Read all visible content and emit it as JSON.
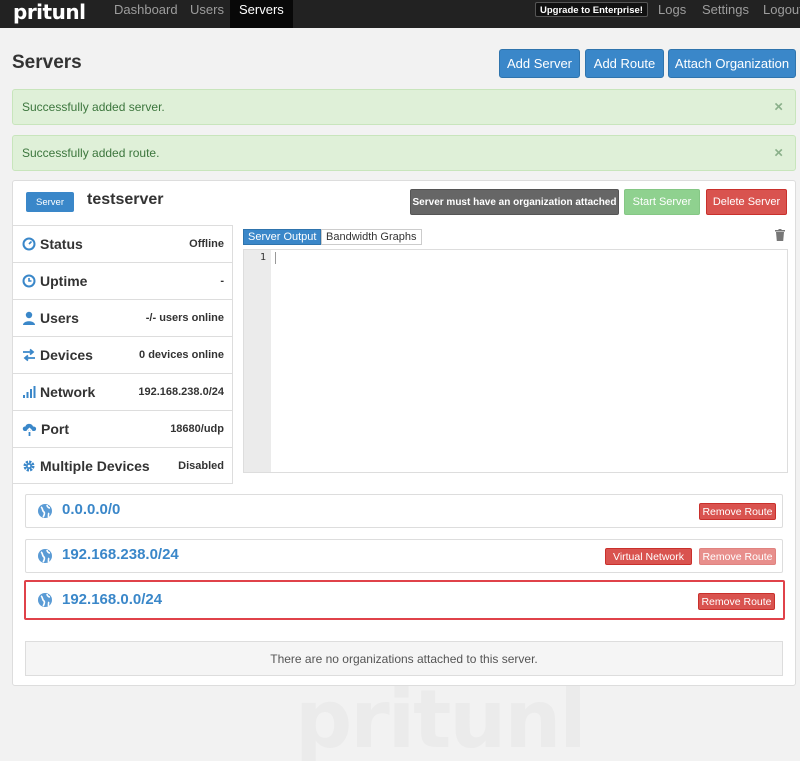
{
  "navbar": {
    "brand": "pritunl",
    "links": [
      "Dashboard",
      "Users",
      "Servers"
    ],
    "active": "Servers",
    "upgrade_label": "Upgrade to Enterprise!",
    "right_links": [
      "Logs",
      "Settings",
      "Logout"
    ]
  },
  "page": {
    "title": "Servers",
    "buttons": [
      "Add Server",
      "Add Route",
      "Attach Organization"
    ]
  },
  "alerts": [
    {
      "text": "Successfully added server.",
      "close": "×"
    },
    {
      "text": "Successfully added route.",
      "close": "×"
    }
  ],
  "server": {
    "badge": "Server",
    "name": "testserver",
    "warning_label": "Server must have an organization attached",
    "start_label": "Start Server",
    "delete_label": "Delete Server",
    "info": [
      {
        "label": "Status",
        "value": "Offline",
        "icon": "status-icon"
      },
      {
        "label": "Uptime",
        "value": "-",
        "icon": "clock-icon"
      },
      {
        "label": "Users",
        "value": "-/- users online",
        "icon": "user-icon"
      },
      {
        "label": "Devices",
        "value": "0 devices online",
        "icon": "devices-icon"
      },
      {
        "label": "Network",
        "value": "192.168.238.0/24",
        "icon": "signal-icon"
      },
      {
        "label": "Port",
        "value": "18680/udp",
        "icon": "upload-cloud-icon"
      },
      {
        "label": "Multiple Devices",
        "value": "Disabled",
        "icon": "gear-icon"
      }
    ],
    "tabs": [
      "Server Output",
      "Bandwidth Graphs"
    ],
    "active_tab": "Server Output",
    "editor_line": "1",
    "routes": [
      {
        "network": "0.0.0.0/0",
        "remove_label": "Remove Route"
      },
      {
        "network": "192.168.238.0/24",
        "tag": "Virtual Network",
        "remove_label": "Remove Route"
      },
      {
        "network": "192.168.0.0/24",
        "remove_label": "Remove Route"
      }
    ],
    "no_org_text": "There are no organizations attached to this server."
  },
  "colors": {
    "primary": "#3a87c9",
    "danger": "#d9534f",
    "success_bg": "#dff0d8",
    "navbar": "#222222"
  }
}
